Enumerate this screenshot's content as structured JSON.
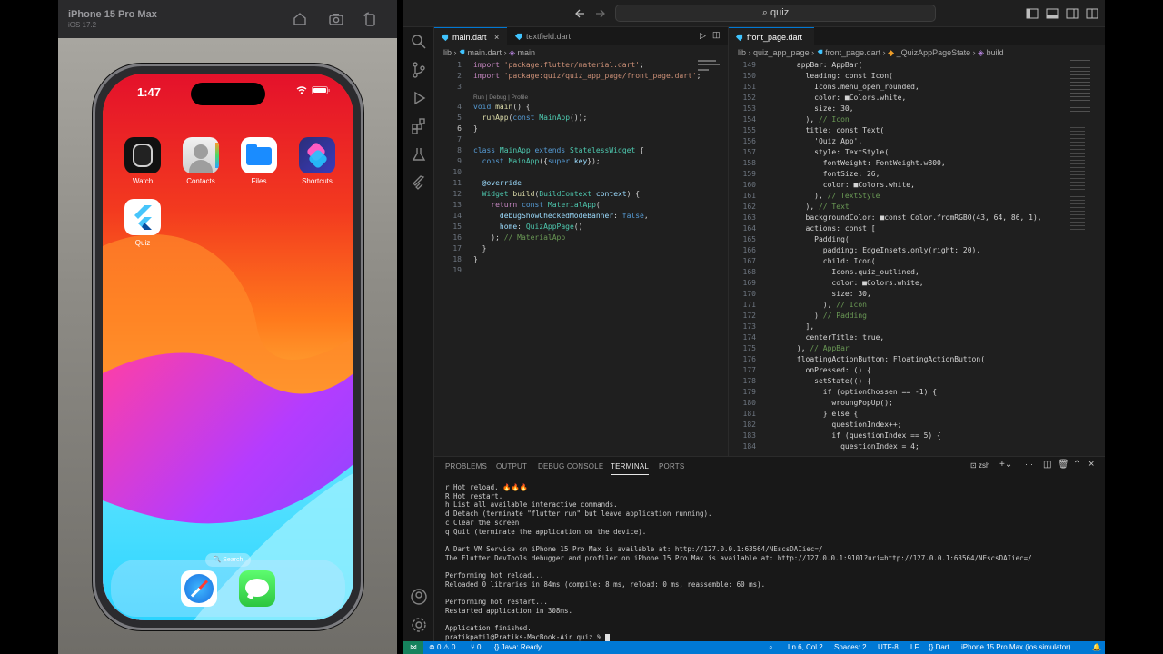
{
  "simulator": {
    "device_name": "iPhone 15 Pro Max",
    "os_version": "iOS 17.2",
    "clock": "1:47",
    "apps": [
      {
        "label": "Watch",
        "icon": "watch-icon"
      },
      {
        "label": "Contacts",
        "icon": "contacts-icon"
      },
      {
        "label": "Files",
        "icon": "files-icon"
      },
      {
        "label": "Shortcuts",
        "icon": "shortcuts-icon"
      },
      {
        "label": "Quiz",
        "icon": "flutter-icon"
      }
    ],
    "search_label": "Search",
    "dock": [
      {
        "icon": "safari-icon"
      },
      {
        "icon": "messages-icon"
      }
    ]
  },
  "vscode": {
    "search": "quiz",
    "left_tabs": [
      {
        "label": "main.dart",
        "active": true
      },
      {
        "label": "textfield.dart",
        "active": false
      }
    ],
    "right_tabs": [
      {
        "label": "front_page.dart",
        "active": true
      }
    ],
    "left_breadcrumb": [
      "lib",
      "main.dart",
      "main"
    ],
    "right_breadcrumb": [
      "lib",
      "quiz_app_page",
      "front_page.dart",
      "_QuizAppPageState",
      "build"
    ],
    "codelens": "Run | Debug | Profile",
    "left_code": [
      {
        "n": "1",
        "t": "import 'package:flutter/material.dart';"
      },
      {
        "n": "2",
        "t": "import 'package:quiz/quiz_app_page/front_page.dart';"
      },
      {
        "n": "3",
        "t": ""
      },
      {
        "n": "4",
        "t": "void main() {"
      },
      {
        "n": "5",
        "t": "  runApp(const MainApp());"
      },
      {
        "n": "6",
        "t": "}"
      },
      {
        "n": "7",
        "t": ""
      },
      {
        "n": "8",
        "t": "class MainApp extends StatelessWidget {"
      },
      {
        "n": "9",
        "t": "  const MainApp({super.key});"
      },
      {
        "n": "10",
        "t": ""
      },
      {
        "n": "11",
        "t": "  @override"
      },
      {
        "n": "12",
        "t": "  Widget build(BuildContext context) {"
      },
      {
        "n": "13",
        "t": "    return const MaterialApp("
      },
      {
        "n": "14",
        "t": "      debugShowCheckedModeBanner: false,"
      },
      {
        "n": "15",
        "t": "      home: QuizAppPage()"
      },
      {
        "n": "16",
        "t": "    ); // MaterialApp"
      },
      {
        "n": "17",
        "t": "  }"
      },
      {
        "n": "18",
        "t": "}"
      },
      {
        "n": "19",
        "t": ""
      }
    ],
    "right_code": [
      {
        "n": "149",
        "t": "      appBar: AppBar("
      },
      {
        "n": "150",
        "t": "        leading: const Icon("
      },
      {
        "n": "151",
        "t": "          Icons.menu_open_rounded,"
      },
      {
        "n": "152",
        "t": "          color: ■Colors.white,"
      },
      {
        "n": "153",
        "t": "          size: 30,"
      },
      {
        "n": "154",
        "t": "        ), // Icon"
      },
      {
        "n": "155",
        "t": "        title: const Text("
      },
      {
        "n": "156",
        "t": "          'Quiz App',"
      },
      {
        "n": "157",
        "t": "          style: TextStyle("
      },
      {
        "n": "158",
        "t": "            fontWeight: FontWeight.w800,"
      },
      {
        "n": "159",
        "t": "            fontSize: 26,"
      },
      {
        "n": "160",
        "t": "            color: ■Colors.white,"
      },
      {
        "n": "161",
        "t": "          ), // TextStyle"
      },
      {
        "n": "162",
        "t": "        ), // Text"
      },
      {
        "n": "163",
        "t": "        backgroundColor: ■const Color.fromRGBO(43, 64, 86, 1),"
      },
      {
        "n": "164",
        "t": "        actions: const ["
      },
      {
        "n": "165",
        "t": "          Padding("
      },
      {
        "n": "166",
        "t": "            padding: EdgeInsets.only(right: 20),"
      },
      {
        "n": "167",
        "t": "            child: Icon("
      },
      {
        "n": "168",
        "t": "              Icons.quiz_outlined,"
      },
      {
        "n": "169",
        "t": "              color: ■Colors.white,"
      },
      {
        "n": "170",
        "t": "              size: 30,"
      },
      {
        "n": "171",
        "t": "            ), // Icon"
      },
      {
        "n": "172",
        "t": "          ) // Padding"
      },
      {
        "n": "173",
        "t": "        ],"
      },
      {
        "n": "174",
        "t": "        centerTitle: true,"
      },
      {
        "n": "175",
        "t": "      ), // AppBar"
      },
      {
        "n": "176",
        "t": "      floatingActionButton: FloatingActionButton("
      },
      {
        "n": "177",
        "t": "        onPressed: () {"
      },
      {
        "n": "178",
        "t": "          setState(() {"
      },
      {
        "n": "179",
        "t": "            if (optionChossen == -1) {"
      },
      {
        "n": "180",
        "t": "              wroungPopUp();"
      },
      {
        "n": "181",
        "t": "            } else {"
      },
      {
        "n": "182",
        "t": "              questionIndex++;"
      },
      {
        "n": "183",
        "t": "              if (questionIndex == 5) {"
      },
      {
        "n": "184",
        "t": "                questionIndex = 4;"
      }
    ],
    "panel_tabs": [
      "PROBLEMS",
      "OUTPUT",
      "DEBUG CONSOLE",
      "TERMINAL",
      "PORTS"
    ],
    "active_panel_tab": "TERMINAL",
    "terminal_shell": "zsh",
    "terminal": [
      "r Hot reload. 🔥🔥🔥",
      "R Hot restart.",
      "h List all available interactive commands.",
      "d Detach (terminate \"flutter run\" but leave application running).",
      "c Clear the screen",
      "q Quit (terminate the application on the device).",
      "",
      "A Dart VM Service on iPhone 15 Pro Max is available at: http://127.0.0.1:63564/NEscsDAIiec=/",
      "The Flutter DevTools debugger and profiler on iPhone 15 Pro Max is available at: http://127.0.0.1:9101?uri=http://127.0.0.1:63564/NEscsDAIiec=/",
      "",
      "Performing hot reload...",
      "Reloaded 0 libraries in 84ms (compile: 8 ms, reload: 0 ms, reassemble: 60 ms).",
      "",
      "Performing hot restart...",
      "Restarted application in 308ms.",
      "",
      "Application finished.",
      "pratikpatil@Pratiks-MacBook-Air quiz % "
    ],
    "status": {
      "errors": "0",
      "warnings": "0",
      "ports": "0",
      "java": "Java: Ready",
      "position": "Ln 6, Col 2",
      "spaces": "Spaces: 2",
      "encoding": "UTF-8",
      "eol": "LF",
      "language": "Dart",
      "device": "iPhone 15 Pro Max (ios simulator)"
    },
    "colors": {
      "accent": "#0078d4",
      "remote": "#16825d"
    }
  }
}
